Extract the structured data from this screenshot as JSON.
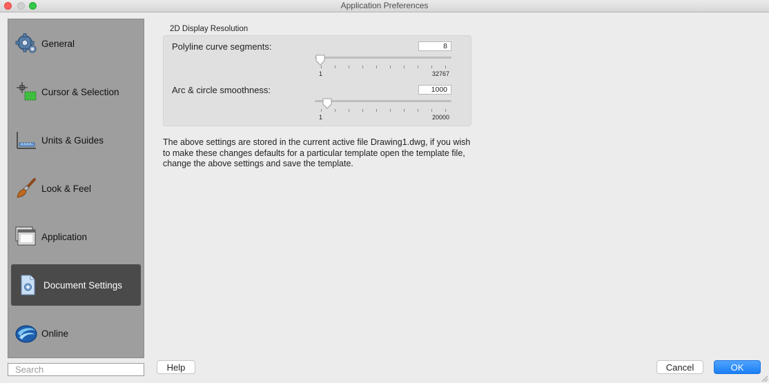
{
  "window": {
    "title": "Application Preferences"
  },
  "sidebar": {
    "items": [
      {
        "label": "General",
        "icon": "gear-icon",
        "active": false
      },
      {
        "label": "Cursor & Selection",
        "icon": "cursor-selection-icon",
        "active": false
      },
      {
        "label": "Units & Guides",
        "icon": "ruler-icon",
        "active": false
      },
      {
        "label": "Look & Feel",
        "icon": "paintbrush-icon",
        "active": false
      },
      {
        "label": "Application",
        "icon": "application-windows-icon",
        "active": false
      },
      {
        "label": "Document Settings",
        "icon": "document-icon",
        "active": true
      },
      {
        "label": "Online",
        "icon": "globe-icon",
        "active": false
      }
    ],
    "search_placeholder": "Search"
  },
  "main": {
    "section_title": "2D Display Resolution",
    "polyline": {
      "label": "Polyline curve segments:",
      "value": "8",
      "min": "1",
      "max": "32767",
      "position": 0.0
    },
    "arc": {
      "label": "Arc & circle smoothness:",
      "value": "1000",
      "min": "1",
      "max": "20000",
      "position": 0.05
    },
    "description": "The above settings are stored in the current active file Drawing1.dwg, if you wish to make these changes defaults for a particular template open the template file, change the above settings and save the template."
  },
  "buttons": {
    "help": "Help",
    "cancel": "Cancel",
    "ok": "OK"
  },
  "colors": {
    "accent": "#1a7ff4",
    "sidebar_bg": "#9e9e9e",
    "active_item_bg": "#4a4a4a"
  }
}
